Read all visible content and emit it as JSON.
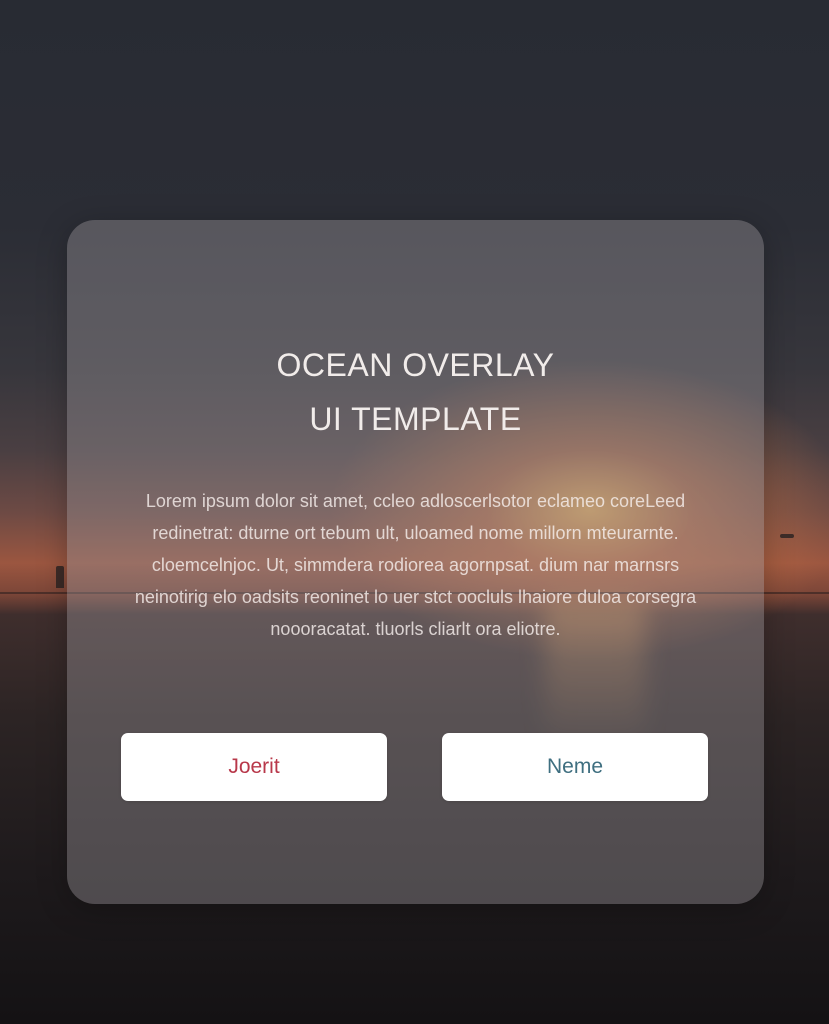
{
  "card": {
    "title_line1": "OCEAN OVERLAY",
    "title_line2": "UI TEMPLATE",
    "body": "Lorem ipsum dolor sit amet, ccleo adloscerlsotor eclameo coreLeed redinetrat: dturne ort tebum ult, uloamed nome millorn mteurarnte. cloemcelnjoc. Ut, simmdera rodiorea agornpsat. dium nar marnsrs neinotirig elo oadsits reoninet lo uer stct oocluls lhaiore duloa corsegra noooracatat. tluorls cliarlt ora eliotre."
  },
  "buttons": {
    "primary_label": "Joerit",
    "secondary_label": "Neme"
  },
  "colors": {
    "primary_text": "#b8384a",
    "secondary_text": "#3f6f80",
    "card_bg": "rgba(150,145,150,0.42)"
  }
}
